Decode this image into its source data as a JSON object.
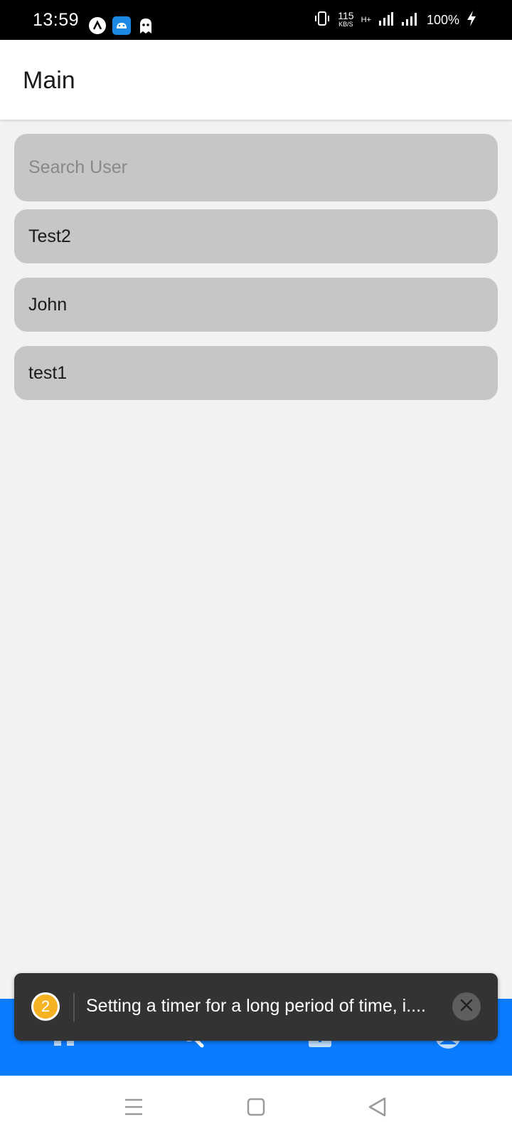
{
  "status_bar": {
    "time": "13:59",
    "net_speed_value": "115",
    "net_speed_unit": "KB/S",
    "network_type": "H+",
    "battery": "100%",
    "icons": [
      "assistant-icon",
      "android-icon",
      "ghost-icon",
      "vibrate-icon",
      "signal-icon",
      "charging-icon"
    ]
  },
  "header": {
    "title": "Main"
  },
  "search": {
    "placeholder": "Search User",
    "value": ""
  },
  "users": [
    {
      "name": "Test2"
    },
    {
      "name": "John"
    },
    {
      "name": "test1"
    }
  ],
  "bottom_tabs": [
    {
      "icon": "home-icon"
    },
    {
      "icon": "search-icon"
    },
    {
      "icon": "add-icon"
    },
    {
      "icon": "profile-icon"
    }
  ],
  "toast": {
    "count": "2",
    "message": "Setting a timer for a long period of time, i...."
  },
  "system_nav": [
    "menu-icon",
    "home-square-icon",
    "back-icon"
  ],
  "colors": {
    "accent": "#0b7cff",
    "badge": "#f5b323",
    "toast_bg": "#333333",
    "item_bg": "#c6c6c6",
    "page_bg": "#f2f2f2"
  }
}
